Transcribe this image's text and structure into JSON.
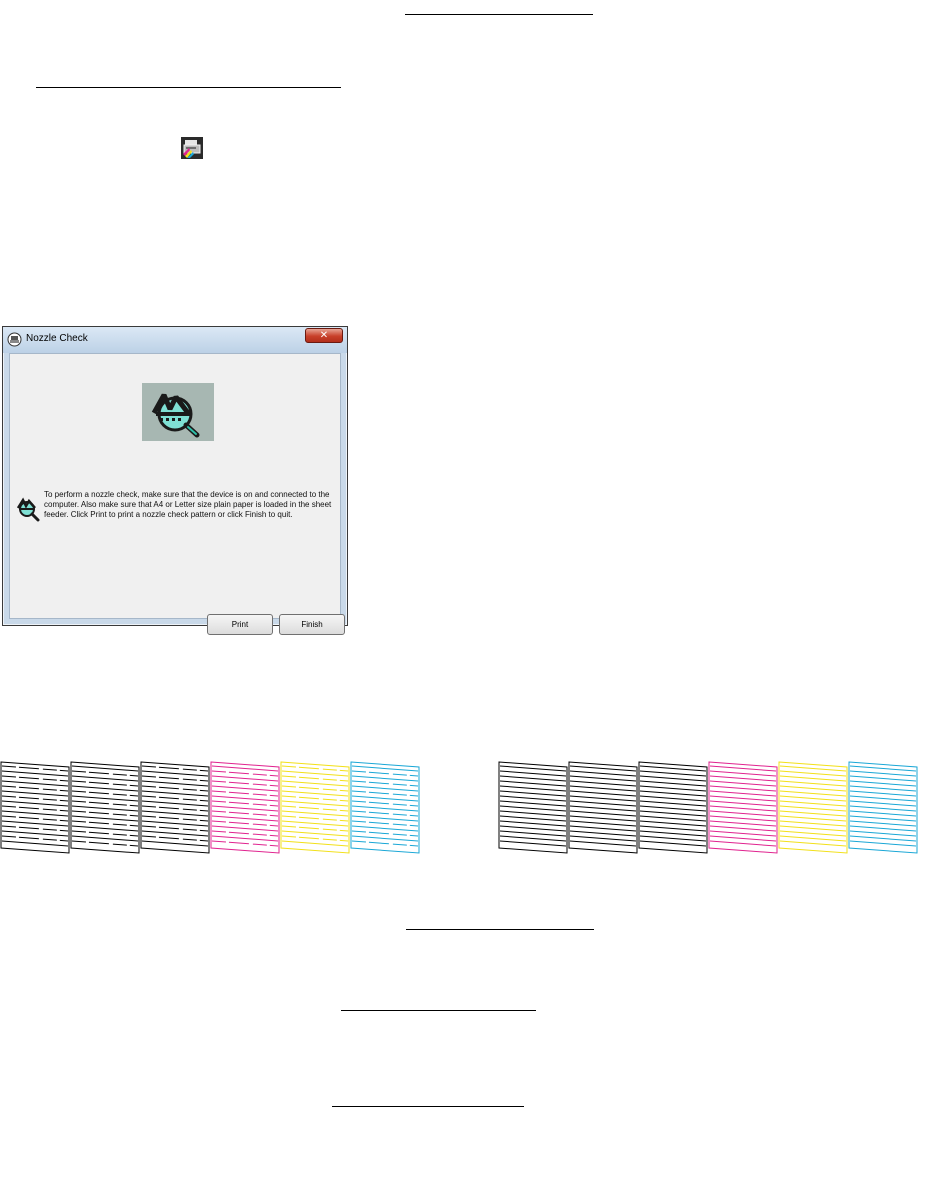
{
  "dialog": {
    "title": "Nozzle Check",
    "message": "To perform a nozzle check, make sure that the device is on and connected to the computer. Also make sure that A4 or Letter size plain paper is loaded in the sheet feeder. Click Print to print a nozzle check pattern or click Finish to quit.",
    "print_label": "Print",
    "finish_label": "Finish",
    "close_glyph": "✕"
  },
  "patterns": [
    {
      "name": "nozzle-pattern-with-gaps",
      "colors": [
        "#000000",
        "#000000",
        "#000000",
        "#e0238f",
        "#f2e01a",
        "#1aa7d6"
      ]
    },
    {
      "name": "nozzle-pattern-complete",
      "colors": [
        "#000000",
        "#000000",
        "#000000",
        "#e0238f",
        "#f2e01a",
        "#1aa7d6"
      ]
    }
  ],
  "icons": {
    "tray": "printer-tray-icon",
    "title": "printer-title-icon",
    "hero": "nozzle-check-icon",
    "message": "nozzle-check-small-icon"
  }
}
